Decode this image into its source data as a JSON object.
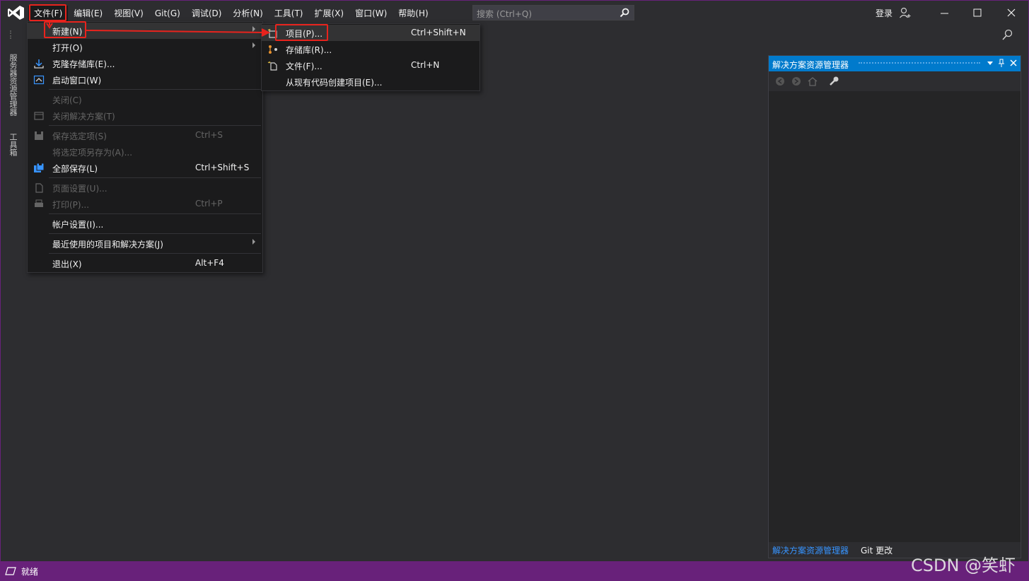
{
  "menubar": {
    "items": [
      "文件(F)",
      "编辑(E)",
      "视图(V)",
      "Git(G)",
      "调试(D)",
      "分析(N)",
      "工具(T)",
      "扩展(X)",
      "窗口(W)",
      "帮助(H)"
    ]
  },
  "search": {
    "placeholder": "搜索 (Ctrl+Q)"
  },
  "account": {
    "login": "登录"
  },
  "left_tabs": {
    "server_explorer": "服务器资源管理器",
    "toolbox": "工具箱"
  },
  "file_menu": {
    "items": [
      {
        "label": "新建(N)",
        "shortcut": "",
        "submenu": true,
        "disabled": false,
        "icon": "none"
      },
      {
        "label": "打开(O)",
        "shortcut": "",
        "submenu": true,
        "disabled": false,
        "icon": "none"
      },
      {
        "label": "克隆存储库(E)...",
        "shortcut": "",
        "submenu": false,
        "disabled": false,
        "icon": "clone-repo-icon"
      },
      {
        "label": "启动窗口(W)",
        "shortcut": "",
        "submenu": false,
        "disabled": false,
        "icon": "start-window-icon"
      },
      {
        "label": "关闭(C)",
        "shortcut": "",
        "submenu": false,
        "disabled": true,
        "icon": "none"
      },
      {
        "label": "关闭解决方案(T)",
        "shortcut": "",
        "submenu": false,
        "disabled": true,
        "icon": "close-solution-icon"
      },
      {
        "label": "保存选定项(S)",
        "shortcut": "Ctrl+S",
        "submenu": false,
        "disabled": true,
        "icon": "save-icon"
      },
      {
        "label": "将选定项另存为(A)...",
        "shortcut": "",
        "submenu": false,
        "disabled": true,
        "icon": "none"
      },
      {
        "label": "全部保存(L)",
        "shortcut": "Ctrl+Shift+S",
        "submenu": false,
        "disabled": false,
        "icon": "save-all-icon"
      },
      {
        "label": "页面设置(U)...",
        "shortcut": "",
        "submenu": false,
        "disabled": true,
        "icon": "page-setup-icon"
      },
      {
        "label": "打印(P)...",
        "shortcut": "Ctrl+P",
        "submenu": false,
        "disabled": true,
        "icon": "print-icon"
      },
      {
        "label": "帐户设置(I)...",
        "shortcut": "",
        "submenu": false,
        "disabled": false,
        "icon": "none"
      },
      {
        "label": "最近使用的项目和解决方案(J)",
        "shortcut": "",
        "submenu": true,
        "disabled": false,
        "icon": "none"
      },
      {
        "label": "退出(X)",
        "shortcut": "Alt+F4",
        "submenu": false,
        "disabled": false,
        "icon": "none"
      }
    ]
  },
  "new_submenu": {
    "items": [
      {
        "label": "项目(P)...",
        "shortcut": "Ctrl+Shift+N",
        "icon": "new-project-icon"
      },
      {
        "label": "存储库(R)...",
        "shortcut": "",
        "icon": "new-repository-icon"
      },
      {
        "label": "文件(F)...",
        "shortcut": "Ctrl+N",
        "icon": "new-file-icon"
      },
      {
        "label": "从现有代码创建项目(E)...",
        "shortcut": "",
        "icon": "none"
      }
    ]
  },
  "solution_explorer": {
    "title": "解决方案资源管理器",
    "tabs": [
      "解决方案资源管理器",
      "Git 更改"
    ]
  },
  "status": {
    "text": "就绪"
  },
  "watermark": "CSDN @笑虾",
  "colors": {
    "accent": "#007acc",
    "status_bar": "#68217a",
    "annotation": "#e8231d",
    "menu_bg": "#1b1b1c"
  }
}
